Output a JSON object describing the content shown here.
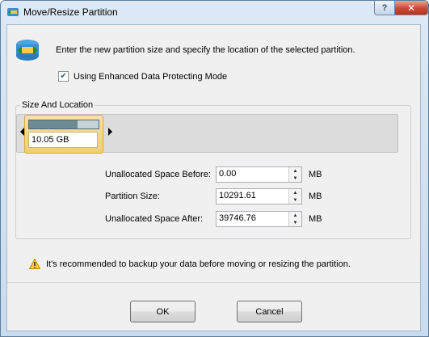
{
  "window": {
    "title": "Move/Resize Partition",
    "help_label": "?",
    "close_label": "✕"
  },
  "intro_text": "Enter the new partition size and specify the location of the selected partition.",
  "protect_mode": {
    "label": "Using Enhanced Data Protecting Mode",
    "checked": true
  },
  "group": {
    "legend": "Size And Location",
    "partition_size_label": "10.05 GB",
    "used_fraction": 0.7
  },
  "fields": [
    {
      "label": "Unallocated Space Before:",
      "value": "0.00",
      "unit": "MB"
    },
    {
      "label": "Partition Size:",
      "value": "10291.61",
      "unit": "MB"
    },
    {
      "label": "Unallocated Space After:",
      "value": "39746.76",
      "unit": "MB"
    }
  ],
  "note_text": "It's recommended to backup your data before moving or resizing the partition.",
  "buttons": {
    "ok": "OK",
    "cancel": "Cancel"
  }
}
